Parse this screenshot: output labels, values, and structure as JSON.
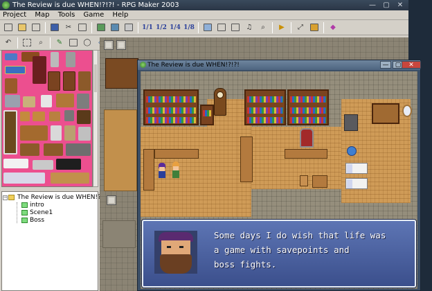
{
  "editor": {
    "title": "The Review is due WHEN!?!?! - RPG Maker 2003",
    "window_controls": [
      "—",
      "▢",
      "✕"
    ],
    "menu": [
      "Project",
      "Map",
      "Tools",
      "Game",
      "Help"
    ],
    "toolbar1_icons": [
      "new-icon",
      "open-icon",
      "close-icon",
      "save-icon",
      "cut-icon",
      "copy-icon",
      "import-icon",
      "chipset-icon",
      "event-layer-icon",
      "map-layer-icon",
      "layer-1-icon",
      "layer-2-icon",
      "layer-4-icon",
      "layer-8-icon",
      "database-icon",
      "material-icon",
      "music-icon",
      "search-icon",
      "playtest-icon",
      "fullscreen-icon",
      "title-icon",
      "help-icon"
    ],
    "zoom_labels": [
      "1/1",
      "1/2",
      "1/4",
      "1/8"
    ],
    "map_tree": {
      "project": "The Review is due WHEN!?!?",
      "maps": [
        "intro",
        "Scene1",
        "Boss"
      ]
    }
  },
  "game_window": {
    "title": "The Review is due WHEN!?!?!",
    "window_controls": [
      "—",
      "▢",
      "✕"
    ],
    "dialog": {
      "line1": "Some days I do wish that life was",
      "line2": "a game with savepoints and",
      "line3": "boss fights."
    }
  },
  "colors": {
    "tileset_bg": "#ec4f8f",
    "dialog_bg": "#4d64a4",
    "floor": "#cf9b57",
    "shelf": "#7a4320"
  }
}
